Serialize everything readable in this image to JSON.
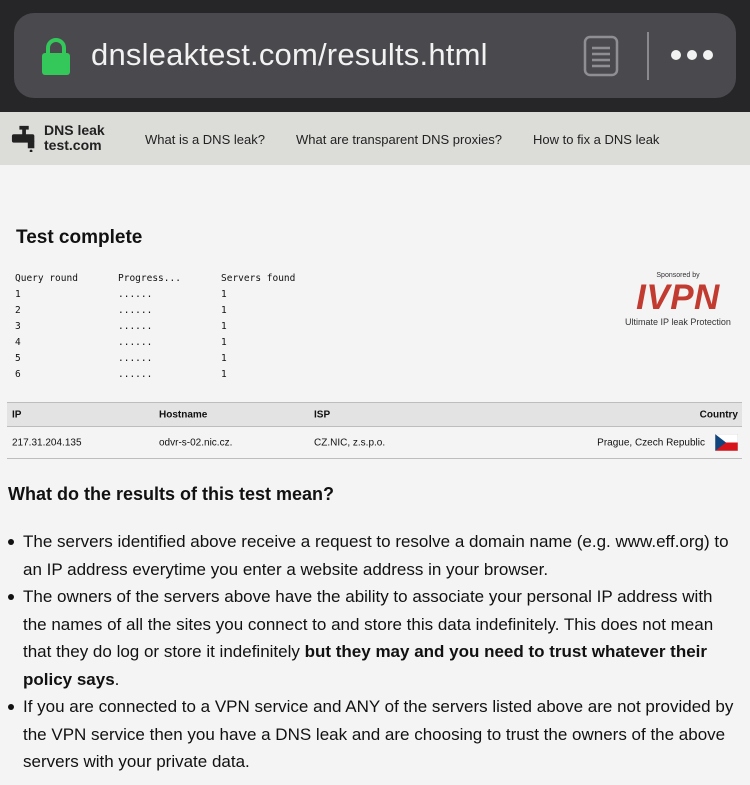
{
  "browser": {
    "url": "dnsleaktest.com/results.html",
    "icons": [
      "lock-icon",
      "reader-view-icon",
      "more-options-icon"
    ],
    "lock_color": "#34c759"
  },
  "site": {
    "logo_line1": "DNS leak",
    "logo_line2": "test.com",
    "nav": [
      "What is a DNS leak?",
      "What are transparent DNS proxies?",
      "How to fix a DNS leak"
    ]
  },
  "test": {
    "title": "Test complete",
    "headers": [
      "Query round",
      "Progress...",
      "Servers found"
    ],
    "rows": [
      [
        "1",
        "......",
        "1"
      ],
      [
        "2",
        "......",
        "1"
      ],
      [
        "3",
        "......",
        "1"
      ],
      [
        "4",
        "......",
        "1"
      ],
      [
        "5",
        "......",
        "1"
      ],
      [
        "6",
        "......",
        "1"
      ]
    ]
  },
  "sponsor": {
    "label": "Sponsored by",
    "brand": "IVPN",
    "tagline": "Ultimate IP leak Protection",
    "brand_color": "#c23b30"
  },
  "results": {
    "headers": [
      "IP",
      "Hostname",
      "ISP",
      "Country"
    ],
    "rows": [
      [
        "217.31.204.135",
        "odvr-s-02.nic.cz.",
        "CZ.NIC, z.s.p.o.",
        "Prague, Czech Republic"
      ]
    ],
    "flag_icon": "czech-flag-icon"
  },
  "explanation": {
    "title": "What do the results of this test mean?",
    "item1": "The servers identified above receive a request to resolve a domain name (e.g. www.eff.org) to an IP address everytime you enter a website address in your browser.",
    "item2_plain": "The owners of the servers above have the ability to associate your personal IP address with the names of all the sites you connect to and store this data indefinitely. This does not mean that they do log or store it indefinitely ",
    "item2_bold": "but they may and you need to trust whatever their policy says",
    "item2_end": ".",
    "item3": "If you are connected to a VPN service and ANY of the servers listed above are not provided by the VPN service then you have a DNS leak and are choosing to trust the owners of the above servers with your private data."
  }
}
